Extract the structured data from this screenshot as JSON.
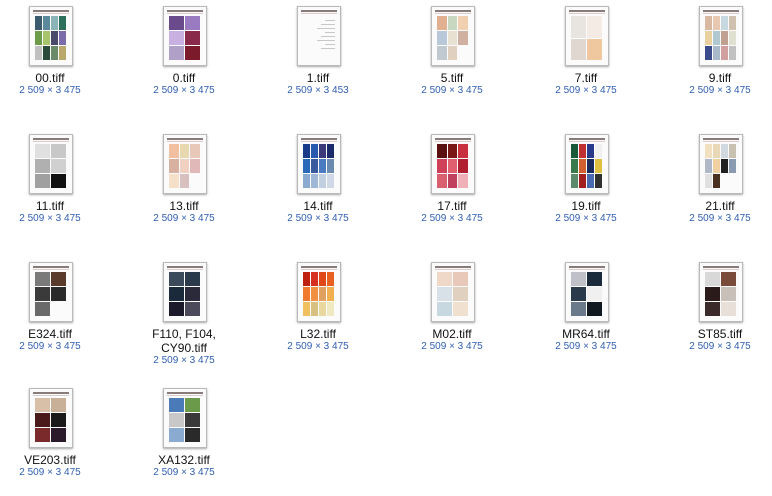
{
  "files": [
    {
      "name": "00.tiff",
      "dims": "2 509 × 3 475",
      "palette": [
        "#3c5a6e",
        "#5c8a9c",
        "#8ab4b8",
        "#2e6f5c",
        "#6c9b4a",
        "#a8c46c",
        "#4a4a6a",
        "#7a6ca8",
        "#c0c0c0",
        "#2a4a3a",
        "#6a8a6a",
        "#b8a86c"
      ]
    },
    {
      "name": "0.tiff",
      "dims": "2 509 × 3 475",
      "palette": [
        "#6a4a8a",
        "#9a7ac0",
        "#c8b0e0",
        "#8a2a4a",
        "#b0a0c8",
        "#7a1a2a"
      ]
    },
    {
      "name": "1.tiff",
      "dims": "2 509 × 3 453",
      "palette": []
    },
    {
      "name": "5.tiff",
      "dims": "2 509 × 3 475",
      "palette": [
        "#e0b090",
        "#c8d8c0",
        "#f0d0b0",
        "#b8c8d8",
        "#e8e0d0",
        "#d0b0a0",
        "#c0c8d0",
        "#e0d0c0"
      ]
    },
    {
      "name": "7.tiff",
      "dims": "2 509 × 3 475",
      "palette": [
        "#e8e4e0",
        "#f4ece4",
        "#e0d8d0",
        "#f0c8a0"
      ]
    },
    {
      "name": "9.tiff",
      "dims": "2 509 × 3 475",
      "palette": [
        "#d8b8a0",
        "#e8c8b0",
        "#c8d8e0",
        "#d0c0b0",
        "#e8d0a0",
        "#b0c8d0",
        "#c0a090",
        "#e0e0d0",
        "#3a4a8a",
        "#a8b8c8",
        "#d0a0a0",
        "#c0c0c0"
      ]
    },
    {
      "name": "11.tiff",
      "dims": "2 509 × 3 475",
      "palette": [
        "#e0e0e0",
        "#c8c8c8",
        "#b0b0b0",
        "#d0d0d0",
        "#a0a0a0",
        "#111111"
      ]
    },
    {
      "name": "13.tiff",
      "dims": "2 509 × 3 475",
      "palette": [
        "#f0c0a0",
        "#e8d8b0",
        "#e8c8b8",
        "#d8b0a0",
        "#f0d0c0",
        "#e0b8b8",
        "#f4e0c8",
        "#d8c0c0"
      ]
    },
    {
      "name": "14.tiff",
      "dims": "2 509 × 3 475",
      "palette": [
        "#1a3a8a",
        "#2a5ab0",
        "#3a3a7a",
        "#1a2a6a",
        "#2a6ab8",
        "#3a5aa0",
        "#4a7ac0",
        "#6a8ab0",
        "#8aaad0",
        "#a0b8d8",
        "#c0d0e0",
        "#d0d8e8"
      ]
    },
    {
      "name": "17.tiff",
      "dims": "2 509 × 3 475",
      "palette": [
        "#5a1010",
        "#7a1818",
        "#c83040",
        "#d04058",
        "#e06070",
        "#b02030",
        "#d86070",
        "#c04060",
        "#f0b0b8"
      ]
    },
    {
      "name": "19.tiff",
      "dims": "2 509 × 3 475",
      "palette": [
        "#1a5a3a",
        "#c03030",
        "#2a3a8a",
        "#f0f0f0",
        "#3a7a4a",
        "#d06030",
        "#1a2a5a",
        "#e0c040",
        "#5a8a6a",
        "#a02020",
        "#4a6ab0",
        "#303030"
      ]
    },
    {
      "name": "21.tiff",
      "dims": "2 509 × 3 475",
      "palette": [
        "#f0e0c0",
        "#e8d8b8",
        "#d0d8e0",
        "#c8c0b0",
        "#b0b8c8",
        "#f0d0a0",
        "#202020",
        "#8a9ab0",
        "#e0e0e0",
        "#4a3020"
      ]
    },
    {
      "name": "E324.tiff",
      "dims": "2 509 × 3 475",
      "palette": [
        "#7a7a7a",
        "#5a3a2a",
        "#3a3a3a",
        "#2a2a2a",
        "#6a6a6a"
      ]
    },
    {
      "name": "F110, F104, CY90.tiff",
      "dims": "2 509 × 3 475",
      "palette": [
        "#3a4a5a",
        "#2a3a4a",
        "#1a2a3a",
        "#2a2a3a",
        "#1a1a2a",
        "#4a4a5a"
      ]
    },
    {
      "name": "L32.tiff",
      "dims": "2 509 × 3 475",
      "palette": [
        "#c02010",
        "#d83020",
        "#e04818",
        "#e86020",
        "#f07a30",
        "#f09040",
        "#e0a060",
        "#f0b050",
        "#f0c060",
        "#d8c080",
        "#e8d8a0",
        "#f0e8c0"
      ]
    },
    {
      "name": "M02.tiff",
      "dims": "2 509 × 3 475",
      "palette": [
        "#f0d8c8",
        "#e8c8b8",
        "#d8e0e8",
        "#e0d0c0",
        "#c8d8e0",
        "#f0e0d0"
      ]
    },
    {
      "name": "MR64.tiff",
      "dims": "2 509 × 3 475",
      "palette": [
        "#c0c0c8",
        "#1a2a3a",
        "#2a3a4a",
        "#f0f0f0",
        "#6a7a8a",
        "#101820"
      ]
    },
    {
      "name": "ST85.tiff",
      "dims": "2 509 × 3 475",
      "palette": [
        "#d8d8d8",
        "#7a4a3a",
        "#2a1a1a",
        "#c8c0b8",
        "#3a2a2a",
        "#e8e0d8"
      ]
    },
    {
      "name": "VE203.tiff",
      "dims": "2 509 × 3 475",
      "palette": [
        "#d8c0a8",
        "#c8b098",
        "#4a1a1a",
        "#1a1a1a",
        "#7a2a2a",
        "#2a1a2a"
      ]
    },
    {
      "name": "XA132.tiff",
      "dims": "2 509 × 3 475",
      "palette": [
        "#4a7ab8",
        "#6a9a4a",
        "#c8c8c8",
        "#3a3a3a",
        "#8aaad0",
        "#2a2a2a"
      ]
    }
  ]
}
